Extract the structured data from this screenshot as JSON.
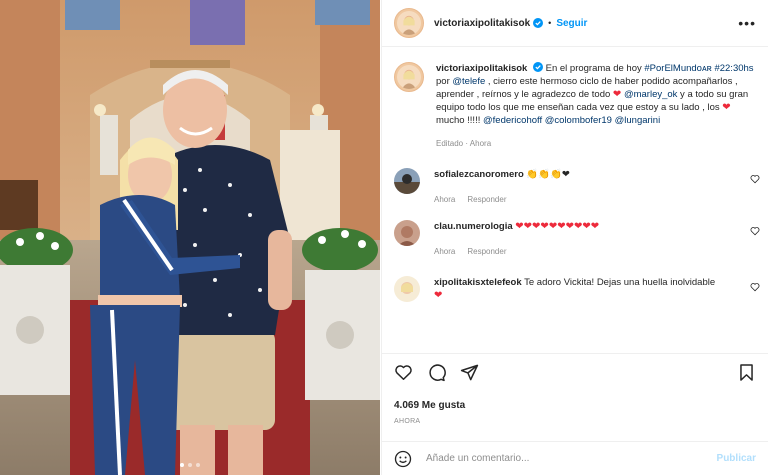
{
  "post": {
    "username": "victoriaxipolitakisok",
    "follow_label": "Seguir",
    "more_label": "•••"
  },
  "caption": {
    "username": "victoriaxipolitakisok",
    "t1": "En el programa de hoy ",
    "tag1": "#PorElMundoᴀʀ",
    "t2": " ",
    "tag2": "#22:30hs",
    "t3": " por ",
    "tag3": "@telefe",
    "t4": " , cierro este hermoso ciclo de haber podido acompañarlos , aprender , reírnos y le agradezco de todo ",
    "tag4": "@marley_ok",
    "t5": " y a todo su gran equipo todo los que me enseñan cada vez que estoy a su lado , los ",
    "t6": " mucho !!!!! ",
    "tag5": "@federicohoff",
    "tag6": "@colombofer19",
    "tag7": "@lungarini",
    "heart": "❤",
    "meta": "Editado · Ahora"
  },
  "comments": [
    {
      "username": "sofialezcanoromero",
      "text": "👏👏👏❤",
      "meta_time": "Ahora",
      "reply": "Responder"
    },
    {
      "username": "clau.numerologia",
      "text": "❤❤❤❤❤❤❤❤❤❤",
      "meta_time": "Ahora",
      "reply": "Responder"
    },
    {
      "username": "xipolitakisxtelefeok",
      "text": "Te adoro Vickita! Dejas una huella inolvidable ",
      "heart": "❤"
    }
  ],
  "actions": {
    "likes": "4.069 Me gusta",
    "time": "AHORA"
  },
  "add_comment": {
    "placeholder": "Añade un comentario...",
    "publish": "Publicar"
  },
  "colors": {
    "accent": "#0095f6",
    "heart": "#ed2a3b",
    "link": "#00376b"
  }
}
